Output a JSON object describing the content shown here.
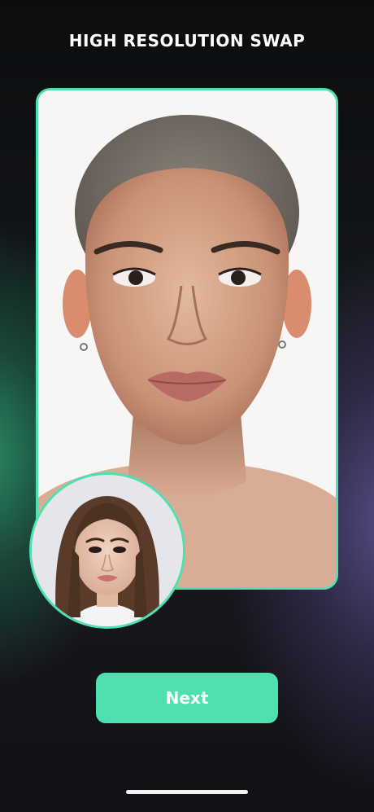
{
  "header": {
    "title": "HIGH RESOLUTION SWAP"
  },
  "main_photo": {
    "icon": "result-face-photo"
  },
  "source_photo": {
    "icon": "source-face-photo"
  },
  "actions": {
    "next_label": "Next"
  },
  "colors": {
    "accent": "#4fe0b0",
    "background_dark": "#121417",
    "glow_green": "#2ea073",
    "glow_purple": "#625496"
  }
}
